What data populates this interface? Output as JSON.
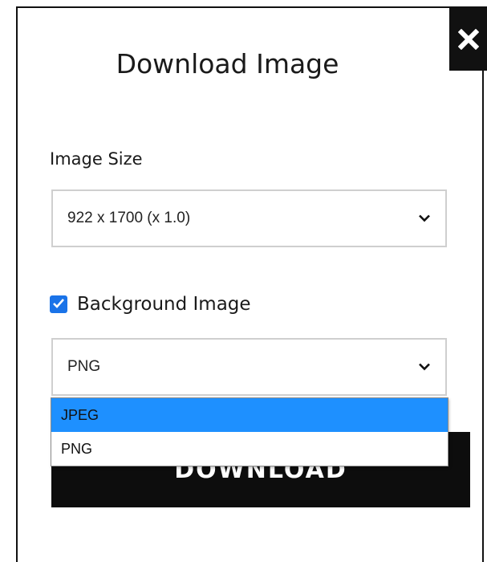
{
  "dialog": {
    "title": "Download Image",
    "close_icon": "close-icon"
  },
  "image_size": {
    "label": "Image Size",
    "selected": "922 x 1700 (x 1.0)",
    "icon": "chevron-down-icon"
  },
  "background_image": {
    "label": "Background Image",
    "checked": true,
    "icon": "checkmark-icon"
  },
  "format": {
    "selected": "PNG",
    "icon": "chevron-down-icon",
    "options": [
      "JPEG",
      "PNG"
    ],
    "highlighted": "JPEG"
  },
  "download_button": {
    "label": "DOWNLOAD"
  },
  "colors": {
    "checkbox_accent": "#1a73e8",
    "option_highlight": "#1e90ff",
    "button_bg": "#0d0d0d"
  }
}
